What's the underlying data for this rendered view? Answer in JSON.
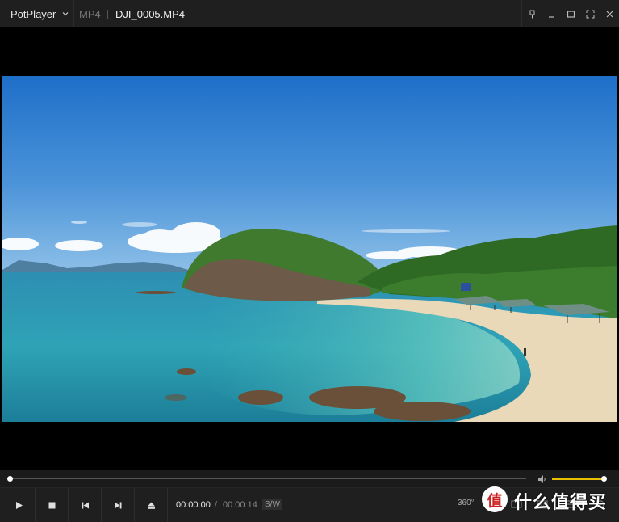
{
  "titlebar": {
    "app_name": "PotPlayer",
    "format": "MP4",
    "file_name": "DJI_0005.MP4"
  },
  "window_controls": [
    "pin-icon",
    "minimize-icon",
    "maximize-icon",
    "fullscreen-icon",
    "close-icon"
  ],
  "playback": {
    "current_time": "00:00:00",
    "separator": "/",
    "total_time": "00:00:14",
    "decoder_badge": "S/W",
    "progress": 0.0,
    "volume": 1.0
  },
  "controls": [
    "play-icon",
    "stop-icon",
    "previous-icon",
    "next-icon",
    "eject-icon"
  ],
  "extra_controls": {
    "vr_label": "360°"
  },
  "watermark": {
    "logo_glyph": "值",
    "text": "什么值得买"
  },
  "colors": {
    "accent": "#e8c000",
    "titlebar_bg": "#1f1f1f",
    "video_bg": "#000000"
  }
}
